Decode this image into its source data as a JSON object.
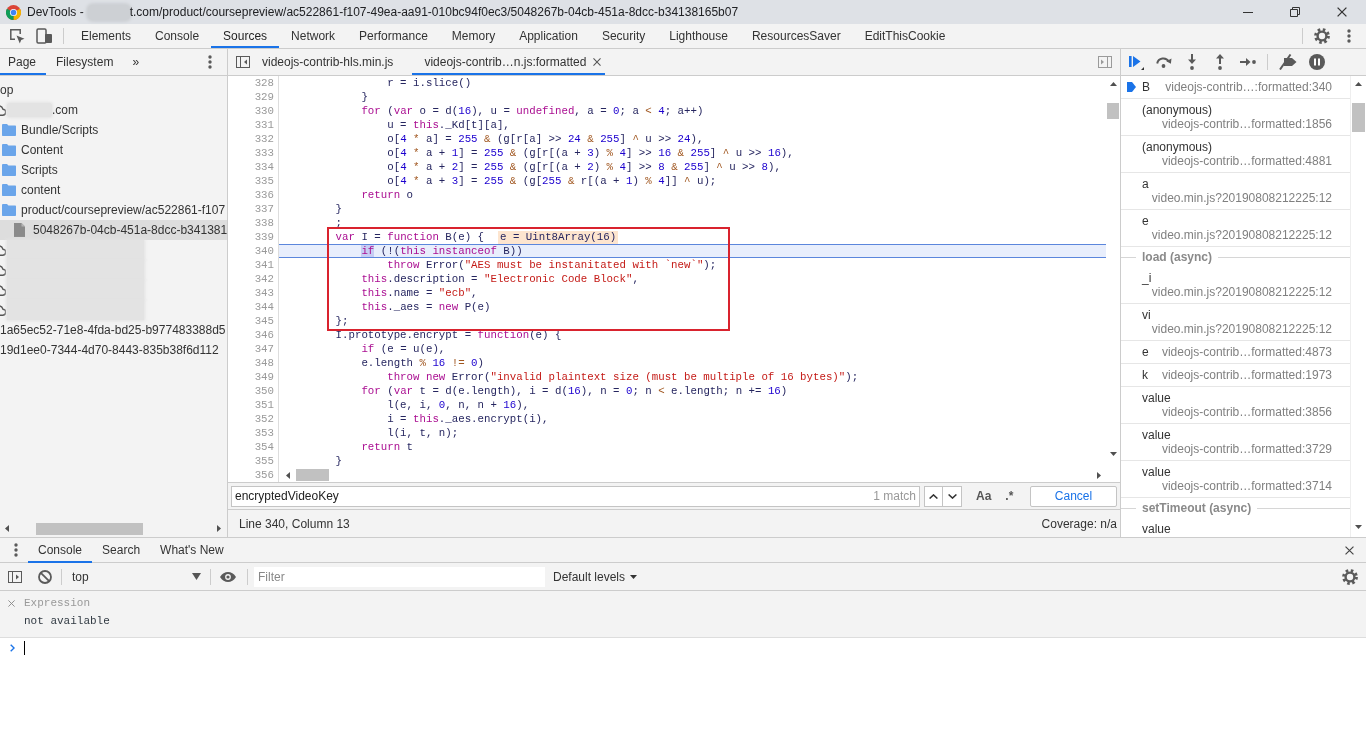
{
  "window": {
    "title": [
      {
        "kind": "text",
        "text": "DevTools -"
      },
      {
        "kind": "redacted"
      },
      {
        "kind": "text",
        "text": "t.com/product/coursepreview/ac522861-f107-49ea-aa91-010bc94f0ec3/5048267b-04cb-451a-8dcc-b34138165b07"
      }
    ]
  },
  "panel_tabs": [
    {
      "label": "Elements",
      "selected": false
    },
    {
      "label": "Console",
      "selected": false
    },
    {
      "label": "Sources",
      "selected": true
    },
    {
      "label": "Network",
      "selected": false
    },
    {
      "label": "Performance",
      "selected": false
    },
    {
      "label": "Memory",
      "selected": false
    },
    {
      "label": "Application",
      "selected": false
    },
    {
      "label": "Security",
      "selected": false
    },
    {
      "label": "Lighthouse",
      "selected": false
    },
    {
      "label": "ResourcesSaver",
      "selected": false
    },
    {
      "label": "EditThisCookie",
      "selected": false
    }
  ],
  "navigator": {
    "tabs": [
      {
        "label": "Page",
        "selected": true
      },
      {
        "label": "Filesystem",
        "selected": false
      }
    ],
    "more": "»",
    "tree": [
      {
        "label": "op",
        "selected": false,
        "children": [
          {
            "kind": "domain",
            "label": ".com",
            "redacted": true,
            "selected": false,
            "children": [
              {
                "kind": "folder",
                "label": "Bundle/Scripts",
                "selected": false
              },
              {
                "kind": "folder",
                "label": "Content",
                "selected": false
              },
              {
                "kind": "folder",
                "label": "Scripts",
                "selected": false
              },
              {
                "kind": "folder",
                "label": "content",
                "selected": false
              },
              {
                "kind": "folder",
                "label": "product/coursepreview/ac522861-f107",
                "selected": false,
                "children": [
                  {
                    "kind": "file",
                    "label": "5048267b-04cb-451a-8dcc-b341381",
                    "selected": true
                  }
                ]
              }
            ]
          },
          {
            "kind": "domain",
            "redacted": true,
            "selected": false
          },
          {
            "kind": "domain",
            "redacted": true,
            "selected": false
          },
          {
            "kind": "domain",
            "redacted": true,
            "selected": false
          },
          {
            "kind": "domain",
            "redacted": true,
            "selected": false
          }
        ]
      },
      {
        "label": "1a65ec52-71e8-4fda-bd25-b977483388d5",
        "selected": false
      },
      {
        "label": "19d1ee0-7344-4d70-8443-835b38f6d112",
        "selected": false
      }
    ]
  },
  "editor": {
    "tabs": [
      {
        "label": "videojs-contrib-hls.min.js",
        "selected": false,
        "closable": false
      },
      {
        "label": "videojs-contrib…n.js:formatted",
        "selected": true,
        "closable": true
      }
    ],
    "lines": [
      {
        "number": "328",
        "current": false,
        "tokens": [
          {
            "kind": "plain",
            "text": "                r = i.slice()"
          }
        ]
      },
      {
        "number": "329",
        "current": false,
        "tokens": [
          {
            "kind": "plain",
            "text": "            }"
          }
        ]
      },
      {
        "number": "330",
        "current": false,
        "tokens": [
          {
            "kind": "keyword",
            "text": "            for"
          },
          {
            "kind": "plain",
            "text": " ("
          },
          {
            "kind": "keyword",
            "text": "var"
          },
          {
            "kind": "plain",
            "text": " o = d("
          },
          {
            "kind": "number",
            "text": "16"
          },
          {
            "kind": "plain",
            "text": "), u = "
          },
          {
            "kind": "keyword",
            "text": "undefined"
          },
          {
            "kind": "plain",
            "text": ", a = "
          },
          {
            "kind": "number",
            "text": "0"
          },
          {
            "kind": "plain",
            "text": "; a "
          },
          {
            "kind": "operator",
            "text": "<"
          },
          {
            "kind": "number",
            "text": " 4"
          },
          {
            "kind": "plain",
            "text": "; a++)"
          }
        ]
      },
      {
        "number": "331",
        "current": false,
        "tokens": [
          {
            "kind": "plain",
            "text": "                u = "
          },
          {
            "kind": "keyword",
            "text": "this"
          },
          {
            "kind": "plain",
            "text": "._Kd[t][a],"
          }
        ]
      },
      {
        "number": "332",
        "current": false,
        "tokens": [
          {
            "kind": "plain",
            "text": "                o["
          },
          {
            "kind": "number",
            "text": "4"
          },
          {
            "kind": "operator",
            "text": " *"
          },
          {
            "kind": "plain",
            "text": " a] = "
          },
          {
            "kind": "number",
            "text": "255"
          },
          {
            "kind": "operator",
            "text": " &"
          },
          {
            "kind": "plain",
            "text": " (g[r[a] >> "
          },
          {
            "kind": "number",
            "text": "24"
          },
          {
            "kind": "operator",
            "text": " &"
          },
          {
            "kind": "number",
            "text": " 255"
          },
          {
            "kind": "plain",
            "text": "] "
          },
          {
            "kind": "operator",
            "text": "^"
          },
          {
            "kind": "plain",
            "text": " u >> "
          },
          {
            "kind": "number",
            "text": "24"
          },
          {
            "kind": "plain",
            "text": "),"
          }
        ]
      },
      {
        "number": "333",
        "current": false,
        "tokens": [
          {
            "kind": "plain",
            "text": "                o["
          },
          {
            "kind": "number",
            "text": "4"
          },
          {
            "kind": "operator",
            "text": " *"
          },
          {
            "kind": "plain",
            "text": " a + "
          },
          {
            "kind": "number",
            "text": "1"
          },
          {
            "kind": "plain",
            "text": "] = "
          },
          {
            "kind": "number",
            "text": "255"
          },
          {
            "kind": "operator",
            "text": " &"
          },
          {
            "kind": "plain",
            "text": " (g[r[(a + "
          },
          {
            "kind": "number",
            "text": "3"
          },
          {
            "kind": "plain",
            "text": ") "
          },
          {
            "kind": "operator",
            "text": "%"
          },
          {
            "kind": "number",
            "text": " 4"
          },
          {
            "kind": "plain",
            "text": "] >> "
          },
          {
            "kind": "number",
            "text": "16"
          },
          {
            "kind": "operator",
            "text": " &"
          },
          {
            "kind": "number",
            "text": " 255"
          },
          {
            "kind": "plain",
            "text": "] "
          },
          {
            "kind": "operator",
            "text": "^"
          },
          {
            "kind": "plain",
            "text": " u >> "
          },
          {
            "kind": "number",
            "text": "16"
          },
          {
            "kind": "plain",
            "text": "),"
          }
        ]
      },
      {
        "number": "334",
        "current": false,
        "tokens": [
          {
            "kind": "plain",
            "text": "                o["
          },
          {
            "kind": "number",
            "text": "4"
          },
          {
            "kind": "operator",
            "text": " *"
          },
          {
            "kind": "plain",
            "text": " a + "
          },
          {
            "kind": "number",
            "text": "2"
          },
          {
            "kind": "plain",
            "text": "] = "
          },
          {
            "kind": "number",
            "text": "255"
          },
          {
            "kind": "operator",
            "text": " &"
          },
          {
            "kind": "plain",
            "text": " (g[r[(a + "
          },
          {
            "kind": "number",
            "text": "2"
          },
          {
            "kind": "plain",
            "text": ") "
          },
          {
            "kind": "operator",
            "text": "%"
          },
          {
            "kind": "number",
            "text": " 4"
          },
          {
            "kind": "plain",
            "text": "] >> "
          },
          {
            "kind": "number",
            "text": "8"
          },
          {
            "kind": "operator",
            "text": " &"
          },
          {
            "kind": "number",
            "text": " 255"
          },
          {
            "kind": "plain",
            "text": "] "
          },
          {
            "kind": "operator",
            "text": "^"
          },
          {
            "kind": "plain",
            "text": " u >> "
          },
          {
            "kind": "number",
            "text": "8"
          },
          {
            "kind": "plain",
            "text": "),"
          }
        ]
      },
      {
        "number": "335",
        "current": false,
        "tokens": [
          {
            "kind": "plain",
            "text": "                o["
          },
          {
            "kind": "number",
            "text": "4"
          },
          {
            "kind": "operator",
            "text": " *"
          },
          {
            "kind": "plain",
            "text": " a + "
          },
          {
            "kind": "number",
            "text": "3"
          },
          {
            "kind": "plain",
            "text": "] = "
          },
          {
            "kind": "number",
            "text": "255"
          },
          {
            "kind": "operator",
            "text": " &"
          },
          {
            "kind": "plain",
            "text": " (g["
          },
          {
            "kind": "number",
            "text": "255"
          },
          {
            "kind": "operator",
            "text": " &"
          },
          {
            "kind": "plain",
            "text": " r[(a + "
          },
          {
            "kind": "number",
            "text": "1"
          },
          {
            "kind": "plain",
            "text": ") "
          },
          {
            "kind": "operator",
            "text": "%"
          },
          {
            "kind": "number",
            "text": " 4"
          },
          {
            "kind": "plain",
            "text": "]] "
          },
          {
            "kind": "operator",
            "text": "^"
          },
          {
            "kind": "plain",
            "text": " u);"
          }
        ]
      },
      {
        "number": "336",
        "current": false,
        "tokens": [
          {
            "kind": "keyword",
            "text": "            return"
          },
          {
            "kind": "plain",
            "text": " o"
          }
        ]
      },
      {
        "number": "337",
        "current": false,
        "tokens": [
          {
            "kind": "plain",
            "text": "        }"
          }
        ]
      },
      {
        "number": "338",
        "current": false,
        "tokens": [
          {
            "kind": "plain",
            "text": "        ;"
          }
        ]
      }
    ],
    "annotated_lines": [
      {
        "number": "339",
        "current": false,
        "tokens": [
          {
            "kind": "keyword",
            "text": "        var"
          },
          {
            "kind": "plain",
            "text": " I = "
          },
          {
            "kind": "keyword",
            "text": "function"
          },
          {
            "kind": "plain",
            "text": " B(e) {"
          }
        ],
        "inline_value": "e = Uint8Array(16)"
      },
      {
        "number": "340",
        "current": true,
        "tokens": [
          {
            "kind": "keyword",
            "text": "            if",
            "highlighted": true
          },
          {
            "kind": "plain",
            "text": " (!("
          },
          {
            "kind": "keyword",
            "text": "this"
          },
          {
            "kind": "keyword",
            "text": " instanceof"
          },
          {
            "kind": "plain",
            "text": " B))"
          }
        ]
      },
      {
        "number": "341",
        "current": false,
        "tokens": [
          {
            "kind": "keyword",
            "text": "                throw"
          },
          {
            "kind": "plain",
            "text": " Error("
          },
          {
            "kind": "string",
            "text": "\"AES must be instanitated with `new`\""
          },
          {
            "kind": "plain",
            "text": ");"
          }
        ]
      },
      {
        "number": "342",
        "current": false,
        "tokens": [
          {
            "kind": "keyword",
            "text": "            this"
          },
          {
            "kind": "plain",
            "text": ".description = "
          },
          {
            "kind": "string",
            "text": "\"Electronic Code Block\""
          },
          {
            "kind": "plain",
            "text": ","
          }
        ]
      },
      {
        "number": "343",
        "current": false,
        "tokens": [
          {
            "kind": "keyword",
            "text": "            this"
          },
          {
            "kind": "plain",
            "text": ".name = "
          },
          {
            "kind": "string",
            "text": "\"ecb\""
          },
          {
            "kind": "plain",
            "text": ","
          }
        ]
      },
      {
        "number": "344",
        "current": false,
        "tokens": [
          {
            "kind": "keyword",
            "text": "            this"
          },
          {
            "kind": "plain",
            "text": "._aes = "
          },
          {
            "kind": "keyword",
            "text": "new"
          },
          {
            "kind": "plain",
            "text": " P(e)"
          }
        ]
      },
      {
        "number": "345",
        "current": false,
        "tokens": [
          {
            "kind": "plain",
            "text": "        };"
          }
        ]
      }
    ],
    "more_lines": [
      {
        "number": "346",
        "current": false,
        "tokens": [
          {
            "kind": "plain",
            "text": "        I.prototype.encrypt = "
          },
          {
            "kind": "keyword",
            "text": "function"
          },
          {
            "kind": "plain",
            "text": "(e) {"
          }
        ]
      },
      {
        "number": "347",
        "current": false,
        "tokens": [
          {
            "kind": "keyword",
            "text": "            if"
          },
          {
            "kind": "plain",
            "text": " (e = u(e),"
          }
        ]
      },
      {
        "number": "348",
        "current": false,
        "tokens": [
          {
            "kind": "plain",
            "text": "            e.length "
          },
          {
            "kind": "operator",
            "text": "%"
          },
          {
            "kind": "number",
            "text": " 16"
          },
          {
            "kind": "operator",
            "text": " !="
          },
          {
            "kind": "number",
            "text": " 0"
          },
          {
            "kind": "plain",
            "text": ")"
          }
        ]
      },
      {
        "number": "349",
        "current": false,
        "tokens": [
          {
            "kind": "keyword",
            "text": "                throw new"
          },
          {
            "kind": "plain",
            "text": " Error("
          },
          {
            "kind": "string",
            "text": "\"invalid plaintext size (must be multiple of 16 bytes)\""
          },
          {
            "kind": "plain",
            "text": ");"
          }
        ]
      },
      {
        "number": "350",
        "current": false,
        "tokens": [
          {
            "kind": "keyword",
            "text": "            for"
          },
          {
            "kind": "plain",
            "text": " ("
          },
          {
            "kind": "keyword",
            "text": "var"
          },
          {
            "kind": "plain",
            "text": " t = d(e.length), i = d("
          },
          {
            "kind": "number",
            "text": "16"
          },
          {
            "kind": "plain",
            "text": "), n = "
          },
          {
            "kind": "number",
            "text": "0"
          },
          {
            "kind": "plain",
            "text": "; n "
          },
          {
            "kind": "operator",
            "text": "<"
          },
          {
            "kind": "plain",
            "text": " e.length; n += "
          },
          {
            "kind": "number",
            "text": "16"
          },
          {
            "kind": "plain",
            "text": ")"
          }
        ]
      },
      {
        "number": "351",
        "current": false,
        "tokens": [
          {
            "kind": "plain",
            "text": "                l(e, i, "
          },
          {
            "kind": "number",
            "text": "0"
          },
          {
            "kind": "plain",
            "text": ", n, n + "
          },
          {
            "kind": "number",
            "text": "16"
          },
          {
            "kind": "plain",
            "text": "),"
          }
        ]
      },
      {
        "number": "352",
        "current": false,
        "tokens": [
          {
            "kind": "plain",
            "text": "                i = "
          },
          {
            "kind": "keyword",
            "text": "this"
          },
          {
            "kind": "plain",
            "text": "._aes.encrypt(i),"
          }
        ]
      },
      {
        "number": "353",
        "current": false,
        "tokens": [
          {
            "kind": "plain",
            "text": "                l(i, t, n);"
          }
        ]
      },
      {
        "number": "354",
        "current": false,
        "tokens": [
          {
            "kind": "keyword",
            "text": "            return"
          },
          {
            "kind": "plain",
            "text": " t"
          }
        ]
      },
      {
        "number": "355",
        "current": false,
        "tokens": [
          {
            "kind": "plain",
            "text": "        }"
          }
        ]
      },
      {
        "number": "356"
      }
    ],
    "search": {
      "value": "encryptedVideoKey",
      "matches": "1 match",
      "case_toggle": "Aa",
      "regex_toggle": ".*",
      "cancel": "Cancel"
    },
    "status": {
      "position": "Line 340, Column 13",
      "coverage": "Coverage: n/a"
    }
  },
  "debugger": {
    "call_stack": [
      {
        "kind": "inline",
        "name": "B",
        "location": "videojs-contrib…:formatted:340",
        "selected": true
      },
      {
        "kind": "wrapped",
        "name": "(anonymous)",
        "location": "videojs-contrib…formatted:1856",
        "selected": false
      },
      {
        "kind": "wrapped",
        "name": "(anonymous)",
        "location": "videojs-contrib…formatted:4881",
        "selected": false
      },
      {
        "kind": "wrapped",
        "name": "a",
        "location": "video.min.js?20190808212225:12",
        "selected": false
      },
      {
        "kind": "wrapped",
        "name": "e",
        "location": "video.min.js?20190808212225:12",
        "selected": false
      },
      {
        "kind": "async",
        "label": "load (async)"
      },
      {
        "kind": "wrapped",
        "name": "_i",
        "location": "video.min.js?20190808212225:12",
        "selected": false
      },
      {
        "kind": "wrapped",
        "name": "vi",
        "location": "video.min.js?20190808212225:12",
        "selected": false
      },
      {
        "kind": "inline",
        "name": "e",
        "location": "videojs-contrib…formatted:4873",
        "selected": false
      },
      {
        "kind": "inline",
        "name": "k",
        "location": "videojs-contrib…formatted:1973",
        "selected": false
      },
      {
        "kind": "wrapped",
        "name": "value",
        "location": "videojs-contrib…formatted:3856",
        "selected": false
      },
      {
        "kind": "wrapped",
        "name": "value",
        "location": "videojs-contrib…formatted:3729",
        "selected": false
      },
      {
        "kind": "wrapped",
        "name": "value",
        "location": "videojs-contrib…formatted:3714",
        "selected": false
      },
      {
        "kind": "async",
        "label": "setTimeout (async)"
      },
      {
        "kind": "wrapped",
        "name": "value",
        "selected": false
      }
    ]
  },
  "drawer": {
    "tabs": [
      {
        "label": "Console",
        "selected": true
      },
      {
        "label": "Search",
        "selected": false
      },
      {
        "label": "What's New",
        "selected": false
      }
    ],
    "context": "top",
    "filter": {
      "placeholder": "Filter"
    },
    "levels": "Default levels",
    "live_expression": {
      "label": "Expression",
      "value": "not available"
    }
  }
}
